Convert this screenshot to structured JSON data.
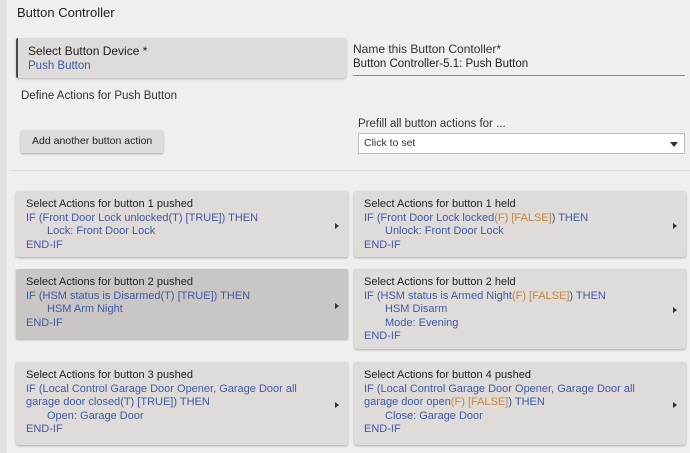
{
  "title": "Button Controller",
  "device": {
    "label": "Select Button Device *",
    "value": "Push Button"
  },
  "name_field": {
    "label": "Name this Button Contoller*",
    "value": "Button Controller-5.1: Push Button"
  },
  "define_label": "Define Actions for Push Button",
  "add_button_label": "Add another button action",
  "prefill": {
    "label": "Prefill all button actions for ...",
    "value": "Click to set"
  },
  "cards": [
    {
      "title": "Select Actions for button 1 pushed",
      "if_pre": "IF (Front Door Lock unlocked",
      "cond_state": "(T) [TRUE]",
      "if_post": ") THEN",
      "actions": [
        "Lock: Front Door Lock"
      ],
      "end": "END-IF"
    },
    {
      "title": "Select Actions for button 1 held",
      "if_pre": "IF (Front Door Lock locked",
      "cond_state": "(F) [FALSE]",
      "if_post": ") THEN",
      "actions": [
        "Unlock: Front Door Lock"
      ],
      "end": "END-IF"
    },
    {
      "title": "Select Actions for button 2 pushed",
      "if_pre": "IF (HSM status is Disarmed",
      "cond_state": "(T) [TRUE]",
      "if_post": ") THEN",
      "actions": [
        "HSM Arm Night"
      ],
      "end": "END-IF"
    },
    {
      "title": "Select Actions for button 2 held",
      "if_pre": "IF (HSM status is Armed Night",
      "cond_state": "(F) [FALSE]",
      "if_post": ") THEN",
      "actions": [
        "HSM Disarm",
        "Mode: Evening"
      ],
      "end": "END-IF"
    },
    {
      "title": "Select Actions for button 3 pushed",
      "if_pre": "IF (Local Control Garage Door Opener, Garage Door all garage door closed",
      "cond_state": "(T) [TRUE]",
      "if_post": ") THEN",
      "actions": [
        "Open: Garage Door"
      ],
      "end": "END-IF"
    },
    {
      "title": "Select Actions for button 4 pushed",
      "if_pre": "IF (Local Control Garage Door Opener, Garage Door all garage door open",
      "cond_state": "(F) [FALSE]",
      "if_post": ") THEN",
      "actions": [
        "Close: Garage Door"
      ],
      "end": "END-IF"
    }
  ],
  "colors": {
    "link_blue": "#3f5aa8",
    "false_orange": "#c8863c",
    "card_bg": "#dedbd8",
    "card_hover_bg": "#c9c6c3",
    "page_bg": "#f1efed"
  },
  "icons": {
    "card_arrow": "chevron-right-icon",
    "select_caret": "caret-down-icon"
  }
}
